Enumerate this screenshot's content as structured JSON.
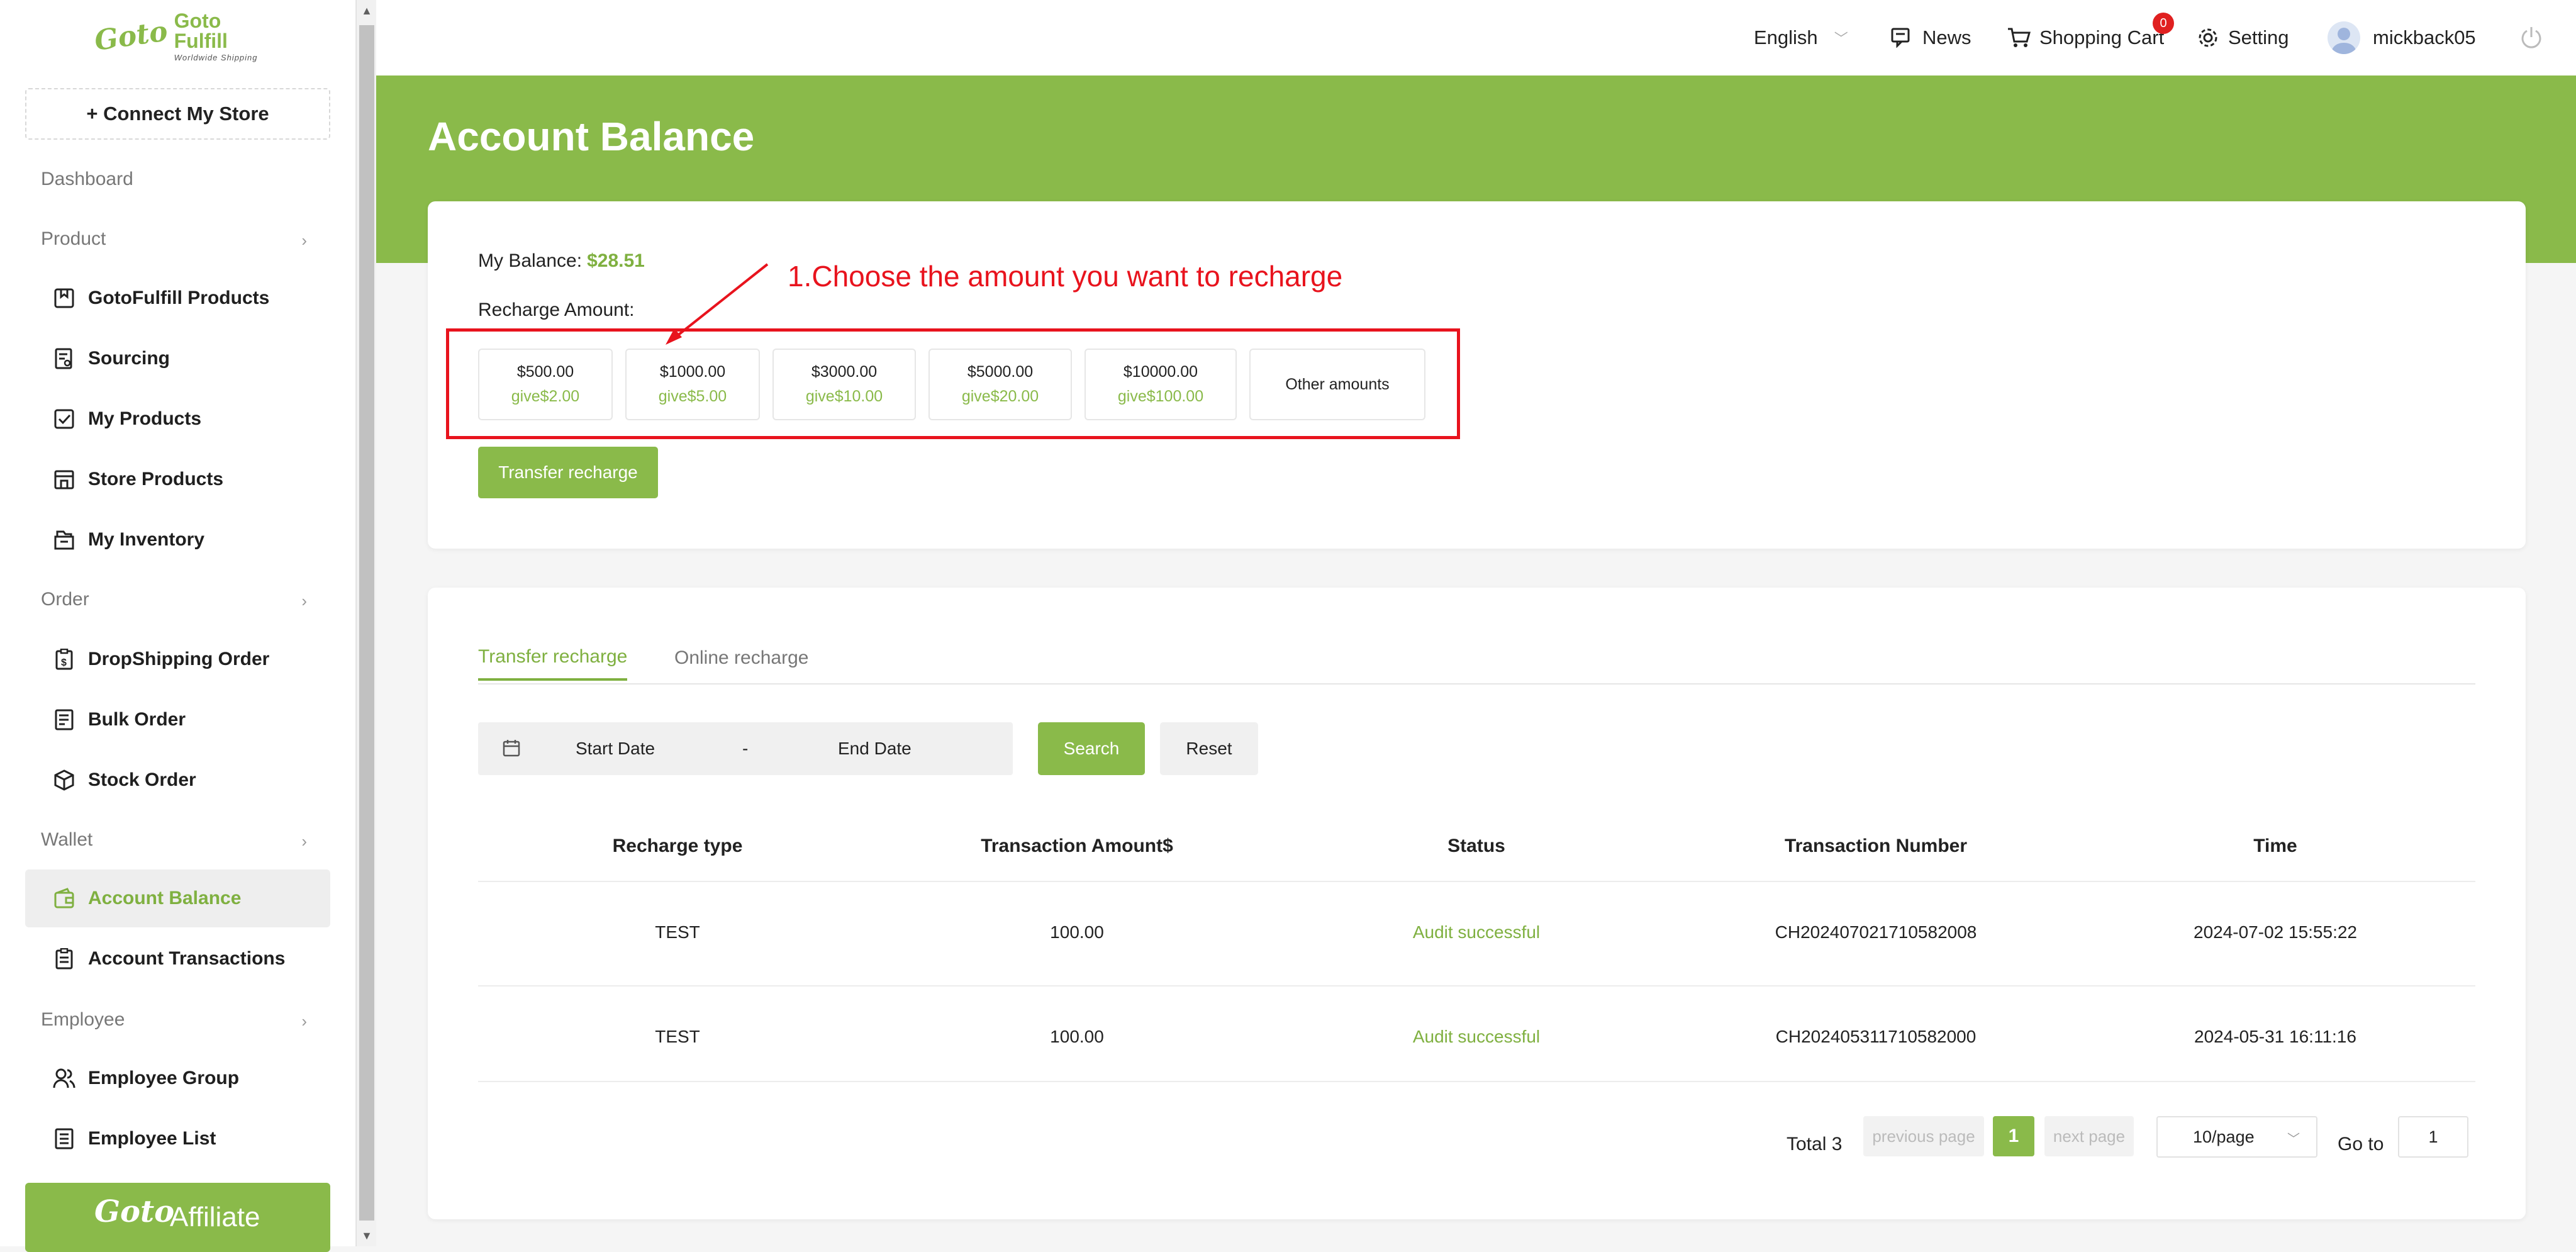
{
  "brand": {
    "logo_mark": "Goto",
    "name": "Goto Fulfill",
    "tagline": "Worldwide Shipping",
    "accent": "#8aba4a",
    "annotation_color": "#e8131d"
  },
  "sidebar": {
    "connect_label": "+ Connect My Store",
    "dashboard": "Dashboard",
    "product_group": "Product",
    "product_items": [
      "GotoFulfill Products",
      "Sourcing",
      "My Products",
      "Store Products",
      "My Inventory"
    ],
    "order_group": "Order",
    "order_items": [
      "DropShipping Order",
      "Bulk Order",
      "Stock Order"
    ],
    "wallet_group": "Wallet",
    "wallet_items": [
      "Account Balance",
      "Account Transactions"
    ],
    "employee_group": "Employee",
    "employee_items": [
      "Employee Group",
      "Employee List"
    ],
    "affiliate_label": "Affiliate",
    "affiliate_mark": "Goto",
    "active_item": "Account Balance"
  },
  "topbar": {
    "language": "English",
    "news": "News",
    "cart": "Shopping Cart",
    "cart_count": "0",
    "setting": "Setting",
    "username": "mickback05"
  },
  "page": {
    "title": "Account Balance"
  },
  "balance": {
    "label": "My Balance:",
    "value": "$28.51",
    "recharge_label": "Recharge Amount:",
    "options": [
      {
        "amount": "$500.00",
        "bonus": "give$2.00"
      },
      {
        "amount": "$1000.00",
        "bonus": "give$5.00"
      },
      {
        "amount": "$3000.00",
        "bonus": "give$10.00"
      },
      {
        "amount": "$5000.00",
        "bonus": "give$20.00"
      },
      {
        "amount": "$10000.00",
        "bonus": "give$100.00"
      }
    ],
    "other_amounts": "Other amounts",
    "transfer_button": "Transfer recharge",
    "annotation": "1.Choose the amount you want to recharge"
  },
  "history": {
    "tabs": [
      "Transfer recharge",
      "Online recharge"
    ],
    "active_tab": "Transfer recharge",
    "start_placeholder": "Start Date",
    "range_sep": "-",
    "end_placeholder": "End Date",
    "search_button": "Search",
    "reset_button": "Reset",
    "columns": [
      "Recharge type",
      "Transaction Amount$",
      "Status",
      "Transaction Number",
      "Time"
    ],
    "rows": [
      {
        "type": "TEST",
        "amount": "100.00",
        "status": "Audit successful",
        "number": "CH202407021710582008",
        "time": "2024-07-02 15:55:22"
      },
      {
        "type": "TEST",
        "amount": "100.00",
        "status": "Audit successful",
        "number": "CH202405311710582000",
        "time": "2024-05-31 16:11:16"
      }
    ]
  },
  "pagination": {
    "total": "Total 3",
    "prev": "previous page",
    "current": "1",
    "next": "next page",
    "page_size": "10/page",
    "goto_label": "Go to",
    "goto_value": "1"
  }
}
